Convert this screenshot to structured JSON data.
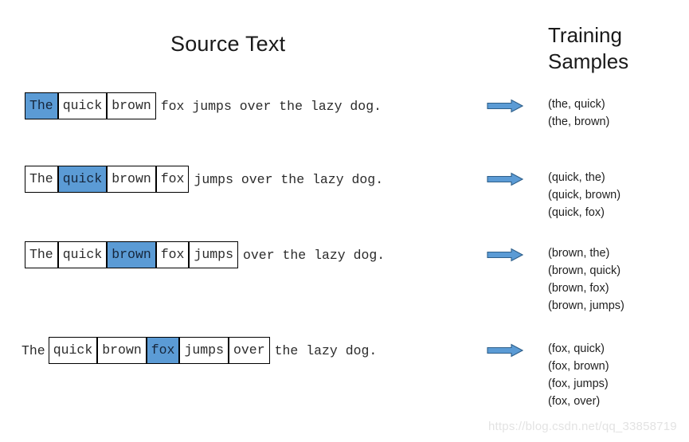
{
  "titles": {
    "source_text": "Source Text",
    "training_samples_line1": "Training",
    "training_samples_line2": "Samples"
  },
  "colors": {
    "highlight": "#5b9bd5",
    "arrow_fill": "#5b9bd5",
    "arrow_stroke": "#2e5f8a",
    "box_border": "#000000",
    "text": "#2b2b2b",
    "watermark": "#e3e3e3"
  },
  "rows": [
    {
      "lead": "",
      "cells": [
        {
          "text": "The",
          "highlighted": true
        },
        {
          "text": "quick",
          "highlighted": false
        },
        {
          "text": "brown",
          "highlighted": false
        }
      ],
      "tail": "fox jumps over the lazy dog.",
      "arrow_label": "implies-arrow"
    },
    {
      "lead": "",
      "cells": [
        {
          "text": "The",
          "highlighted": false
        },
        {
          "text": "quick",
          "highlighted": true
        },
        {
          "text": "brown",
          "highlighted": false
        },
        {
          "text": "fox",
          "highlighted": false
        }
      ],
      "tail": "jumps over the lazy dog.",
      "arrow_label": "implies-arrow"
    },
    {
      "lead": "",
      "cells": [
        {
          "text": "The",
          "highlighted": false
        },
        {
          "text": "quick",
          "highlighted": false
        },
        {
          "text": "brown",
          "highlighted": true
        },
        {
          "text": "fox",
          "highlighted": false
        },
        {
          "text": "jumps",
          "highlighted": false
        }
      ],
      "tail": "over the lazy dog.",
      "arrow_label": "implies-arrow"
    },
    {
      "lead": "The",
      "cells": [
        {
          "text": "quick",
          "highlighted": false
        },
        {
          "text": "brown",
          "highlighted": false
        },
        {
          "text": "fox",
          "highlighted": true
        },
        {
          "text": "jumps",
          "highlighted": false
        },
        {
          "text": "over",
          "highlighted": false
        }
      ],
      "tail": "the lazy dog.",
      "arrow_label": "implies-arrow"
    }
  ],
  "sample_groups": [
    [
      "(the, quick)",
      "(the, brown)"
    ],
    [
      "(quick, the)",
      "(quick, brown)",
      "(quick, fox)"
    ],
    [
      "(brown, the)",
      "(brown, quick)",
      "(brown, fox)",
      "(brown, jumps)"
    ],
    [
      "(fox, quick)",
      "(fox, brown)",
      "(fox, jumps)",
      "(fox, over)"
    ]
  ],
  "watermark": "https://blog.csdn.net/qq_33858719"
}
